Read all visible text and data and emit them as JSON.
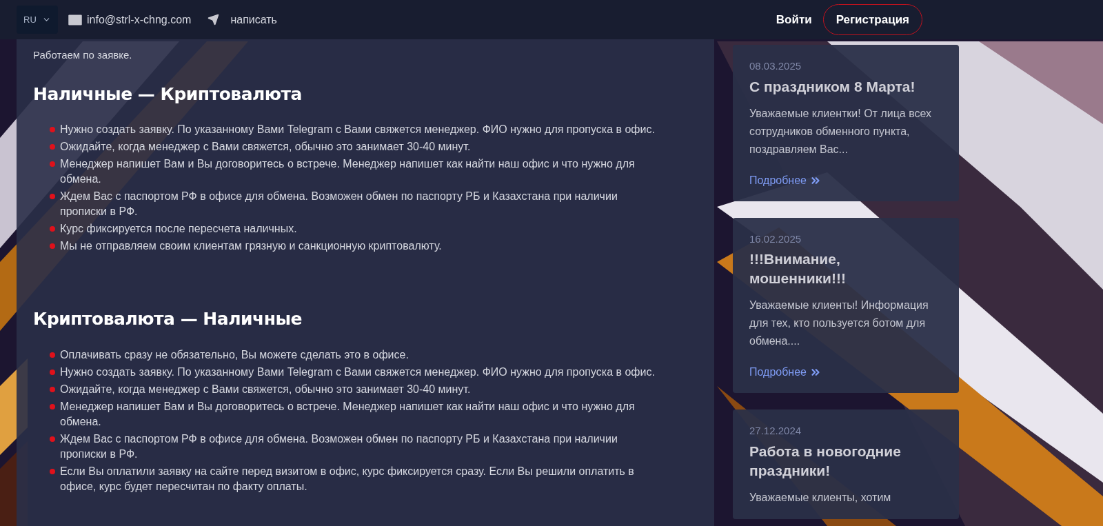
{
  "header": {
    "language": {
      "label": "RU"
    },
    "email": "info@strl-x-chng.com",
    "telegram": "написать",
    "login": "Войти",
    "register": "Регистрация"
  },
  "main": {
    "intro": "Работаем по заявке.",
    "sections": [
      {
        "title": "Наличные — Криптовалюта",
        "items": [
          "Нужно создать заявку. По указанному Вами Telegram с Вами свяжется менеджер. ФИО нужно для пропуска в офис.",
          "Ожидайте, когда менеджер с Вами свяжется, обычно это занимает 30-40 минут.",
          "Менеджер напишет Вам и Вы договоритесь о встрече. Менеджер напишет как найти наш офис и что нужно для обмена.",
          "Ждем Вас с паспортом РФ в офисе для обмена. Возможен обмен по паспорту РБ и Казахстана при наличии прописки в РФ.",
          "Курс фиксируется после пересчета наличных.",
          "Мы не отправляем своим клиентам грязную и санкционную криптовалюту."
        ]
      },
      {
        "title": "Криптовалюта — Наличные",
        "items": [
          "Оплачивать сразу не обязательно, Вы можете сделать это в офисе.",
          "Нужно создать заявку. По указанному Вами Telegram с Вами свяжется менеджер. ФИО нужно для пропуска в офис.",
          "Ожидайте, когда менеджер с Вами свяжется, обычно это занимает 30-40 минут.",
          "Менеджер напишет Вам и Вы договоритесь о встрече. Менеджер напишет как найти наш офис и что нужно для обмена.",
          "Ждем Вас с паспортом РФ в офисе для обмена. Возможен обмен по паспорту РБ и Казахстана при наличии прописки в РФ.",
          "Если Вы оплатили заявку на сайте перед визитом в офис, курс фиксируется сразу. Если Вы решили оплатить в офисе, курс будет пересчитан по факту оплаты."
        ]
      }
    ]
  },
  "news": [
    {
      "date": "08.03.2025",
      "title": "С праздником 8 Марта!",
      "excerpt": "Уважаемые клиентки! От лица всех сотрудников обменного пункта, поздравляем Вас...",
      "more": "Подробнее"
    },
    {
      "date": "16.02.2025",
      "title": "!!!Внимание, мошенники!!!",
      "excerpt": "Уважаемые клиенты! Информация для тех, кто пользуется ботом для обмена....",
      "more": "Подробнее"
    },
    {
      "date": "27.12.2024",
      "title": "Работа в новогодние праздники!",
      "excerpt": "Уважаемые клиенты, хотим"
    }
  ]
}
